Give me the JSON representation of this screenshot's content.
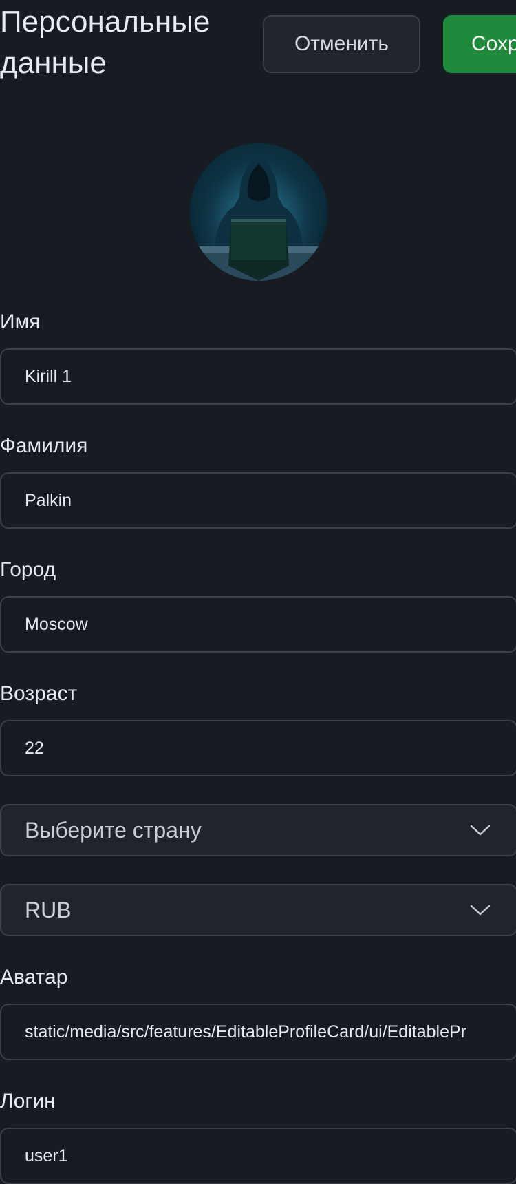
{
  "header": {
    "title": "Персональные данные",
    "cancel_label": "Отменить",
    "save_label": "Сохр"
  },
  "avatar": {
    "icon": "hooded-hacker-avatar"
  },
  "fields": {
    "first_name": {
      "label": "Имя",
      "value": "Kirill 1"
    },
    "last_name": {
      "label": "Фамилия",
      "value": "Palkin"
    },
    "city": {
      "label": "Город",
      "value": "Moscow"
    },
    "age": {
      "label": "Возраст",
      "value": "22"
    },
    "country": {
      "value": "Выберите страну"
    },
    "currency": {
      "value": "RUB"
    },
    "avatar_path": {
      "label": "Аватар",
      "value": "static/media/src/features/EditableProfileCard/ui/EditablePr"
    },
    "login": {
      "label": "Логин",
      "value": "user1"
    }
  },
  "colors": {
    "background": "#171b22",
    "save_button": "#1f8a3c",
    "border": "#3a3f48"
  }
}
